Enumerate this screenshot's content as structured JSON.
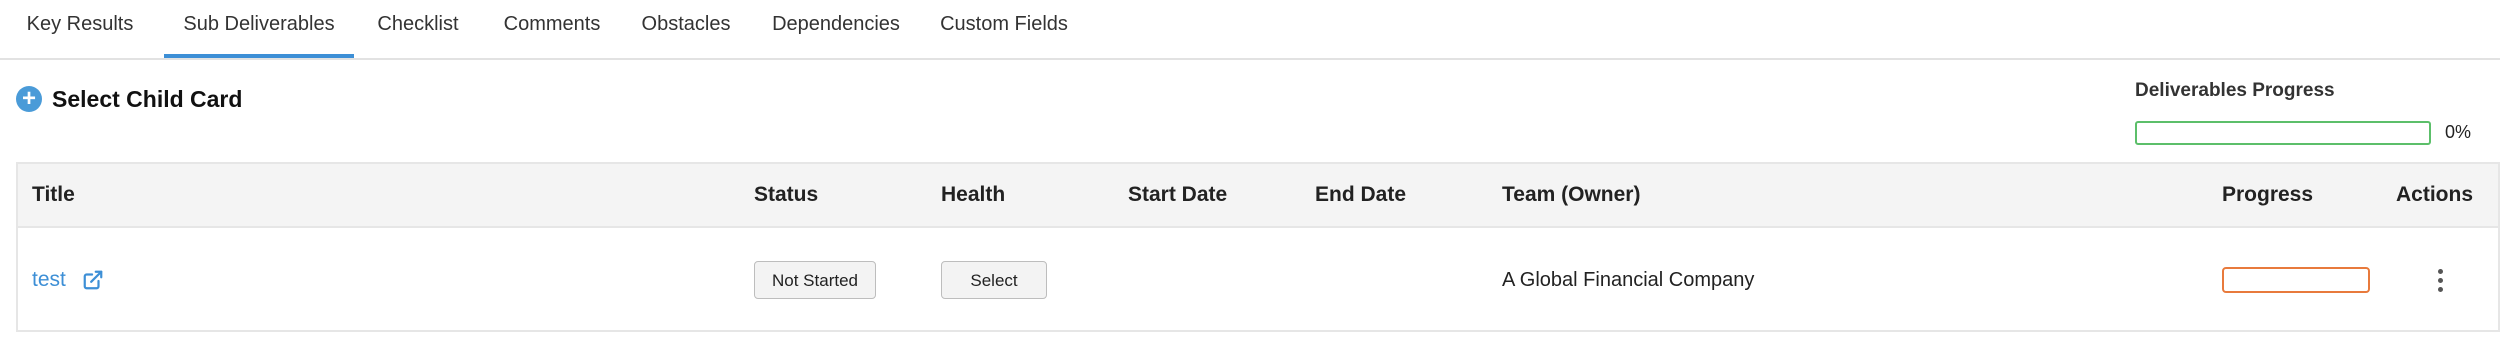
{
  "tabs": [
    {
      "label": "Key Results",
      "active": false
    },
    {
      "label": "Sub Deliverables",
      "active": true
    },
    {
      "label": "Checklist",
      "active": false
    },
    {
      "label": "Comments",
      "active": false
    },
    {
      "label": "Obstacles",
      "active": false
    },
    {
      "label": "Dependencies",
      "active": false
    },
    {
      "label": "Custom Fields",
      "active": false
    }
  ],
  "toolbar": {
    "select_child_label": "Select Child Card",
    "plus_icon": "plus-circle-icon"
  },
  "deliverables_progress": {
    "title": "Deliverables Progress",
    "value_label": "0%",
    "fraction": 0
  },
  "table": {
    "columns": [
      "Title",
      "Status",
      "Health",
      "Start Date",
      "End Date",
      "Team (Owner)",
      "Progress",
      "Actions"
    ],
    "rows": [
      {
        "title": "test",
        "status": "Not Started",
        "health": "Select",
        "start_date": "",
        "end_date": "",
        "team": "A Global Financial Company",
        "progress_fraction": 0,
        "link_icon": "external-link-icon",
        "actions_icon": "kebab-menu-icon"
      }
    ]
  },
  "colors": {
    "accent": "#3d8fd6",
    "progress_green": "#5cbf6a",
    "progress_orange": "#e87a3c",
    "header_bg": "#f4f4f4"
  }
}
